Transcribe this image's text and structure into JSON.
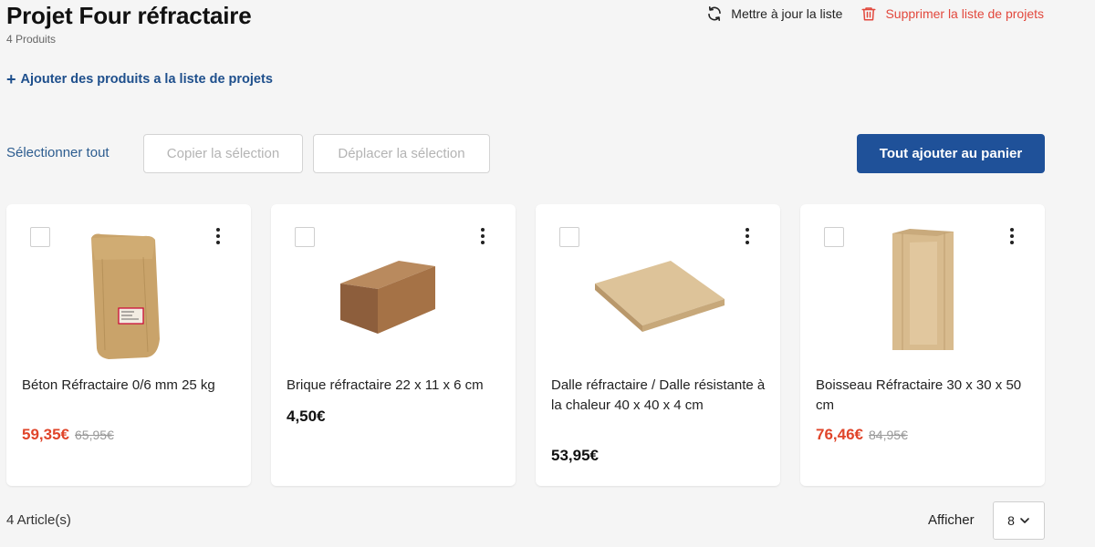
{
  "header": {
    "title": "Projet Four réfractaire",
    "subtitle": "4 Produits",
    "update_label": "Mettre à jour la liste",
    "delete_label": "Supprimer la liste de projets"
  },
  "add_products_label": "Ajouter des produits a la liste de projets",
  "toolbar": {
    "select_all": "Sélectionner tout",
    "copy_selection": "Copier la sélection",
    "move_selection": "Déplacer la sélection",
    "add_all_to_cart": "Tout ajouter au panier"
  },
  "products": [
    {
      "name": "Béton Réfractaire 0/6 mm 25 kg",
      "price": "59,35€",
      "old_price": "65,95€",
      "image": "bag-image"
    },
    {
      "name": "Brique réfractaire 22 x 11 x 6 cm",
      "price": "4,50€",
      "old_price": "",
      "image": "brick-image"
    },
    {
      "name": "Dalle réfractaire / Dalle résistante à la chaleur 40 x 40 x 4 cm",
      "price": "53,95€",
      "old_price": "",
      "image": "slab-image"
    },
    {
      "name": "Boisseau Réfractaire 30 x 30 x 50 cm",
      "price": "76,46€",
      "old_price": "84,95€",
      "image": "flue-image"
    }
  ],
  "footer": {
    "count_label": "4 Article(s)",
    "show_label": "Afficher",
    "per_page": "8"
  },
  "colors": {
    "primary": "#1f5199",
    "sale_price": "#e0452a",
    "delete": "#e2483d",
    "link": "#1e4f8c"
  }
}
